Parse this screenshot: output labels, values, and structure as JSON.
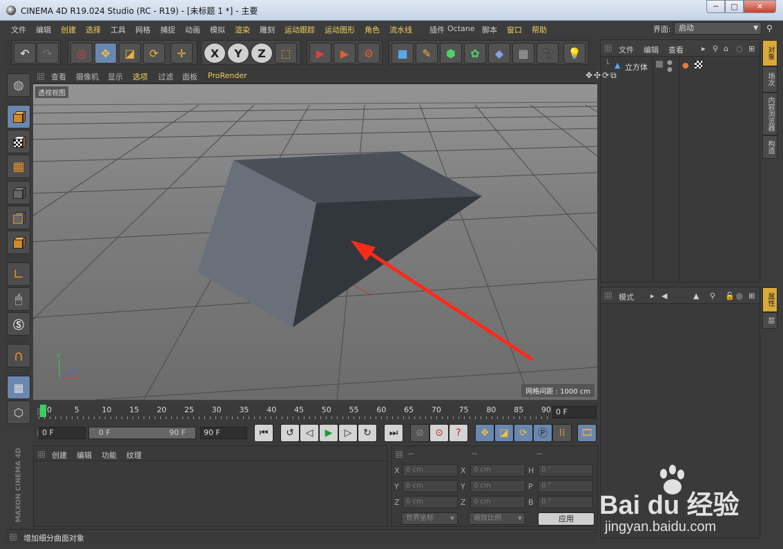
{
  "window": {
    "title": "CINEMA 4D R19.024 Studio (RC - R19) - [未标题 1 *] - 主要",
    "min": "─",
    "max": "□",
    "close": "✕"
  },
  "menu": {
    "items": [
      {
        "label": "文件",
        "hl": false
      },
      {
        "label": "编辑",
        "hl": false
      },
      {
        "label": "创建",
        "hl": true
      },
      {
        "label": "选择",
        "hl": true
      },
      {
        "label": "工具",
        "hl": false
      },
      {
        "label": "网格",
        "hl": false
      },
      {
        "label": "捕捉",
        "hl": false
      },
      {
        "label": "动画",
        "hl": false
      },
      {
        "label": "模拟",
        "hl": false
      },
      {
        "label": "渲染",
        "hl": true
      },
      {
        "label": "雕刻",
        "hl": false
      },
      {
        "label": "运动跟踪",
        "hl": true
      },
      {
        "label": "运动图形",
        "hl": true
      },
      {
        "label": "角色",
        "hl": true
      },
      {
        "label": "流水线",
        "hl": true
      },
      {
        "label": "插件",
        "hl": false
      },
      {
        "label": "Octane",
        "hl": false
      },
      {
        "label": "脚本",
        "hl": false
      },
      {
        "label": "窗口",
        "hl": true
      },
      {
        "label": "帮助",
        "hl": true
      }
    ],
    "layout_label": "界面:",
    "layout_value": "启动"
  },
  "object_panel": {
    "tabs": [
      "文件",
      "编辑",
      "查看"
    ],
    "object_name": "立方体"
  },
  "right_tabs_top": [
    "对象",
    "场次",
    "内容浏览器",
    "构造"
  ],
  "right_tabs_bottom": [
    "属性",
    "层"
  ],
  "attr_panel": {
    "mode_label": "模式"
  },
  "viewport": {
    "menu": [
      {
        "label": "查看",
        "hl": false
      },
      {
        "label": "摄像机",
        "hl": false
      },
      {
        "label": "显示",
        "hl": false
      },
      {
        "label": "选项",
        "hl": true
      },
      {
        "label": "过滤",
        "hl": false
      },
      {
        "label": "面板",
        "hl": false
      },
      {
        "label": "ProRender",
        "hl": true
      }
    ],
    "view_name": "透视视图",
    "grid_spacing": "网格间距 : 1000 cm",
    "axis_x": "X",
    "axis_y": "Y",
    "axis_z": "Z"
  },
  "timeline": {
    "ticks": [
      "0",
      "5",
      "10",
      "15",
      "20",
      "25",
      "30",
      "35",
      "40",
      "45",
      "50",
      "55",
      "60",
      "65",
      "70",
      "75",
      "80",
      "85",
      "90"
    ],
    "current_frame": "0 F"
  },
  "transport": {
    "start": "0 F",
    "range_start": "0 F",
    "range_end": "90 F",
    "end": "90 F"
  },
  "material_manager": {
    "menu": [
      "创建",
      "编辑",
      "功能",
      "纹理"
    ]
  },
  "coordinates": {
    "header": [
      "--",
      "--",
      "--"
    ],
    "rows": [
      {
        "a": "X",
        "av": "0 cm",
        "b": "X",
        "bv": "0 cm",
        "c": "H",
        "cv": "0 °"
      },
      {
        "a": "Y",
        "av": "0 cm",
        "b": "Y",
        "bv": "0 cm",
        "c": "P",
        "cv": "0 °"
      },
      {
        "a": "Z",
        "av": "0 cm",
        "b": "Z",
        "bv": "0 cm",
        "c": "B",
        "cv": "0 °"
      }
    ],
    "coord_system": "世界坐标",
    "scale_mode": "缩放比例",
    "apply": "应用"
  },
  "status": {
    "text": "增加细分曲面对象"
  },
  "branding": {
    "maxon": "MAXON CINEMA 4D"
  },
  "watermark": {
    "text": "Bai  du 经验",
    "url": "jingyan.baidu.com"
  },
  "colors": {
    "accent": "#f0d060",
    "annotation_arrow": "#ff2a1a",
    "cube": "#5f6570"
  }
}
